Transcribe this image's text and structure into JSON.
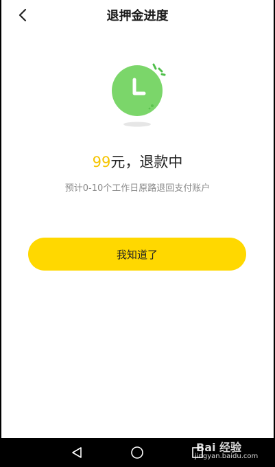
{
  "header": {
    "title": "退押金进度"
  },
  "status": {
    "amount": "99",
    "text": "元，退款中"
  },
  "subtitle": "预计0-10个工作日原路退回支付账户",
  "button": {
    "label": "我知道了"
  },
  "colors": {
    "accent": "#ffd800",
    "amount": "#f5c400",
    "clock": "#7bd66a",
    "clock_dark": "#4fbf4a"
  },
  "icons": {
    "back": "chevron-left-icon",
    "clock": "clock-icon",
    "nav_back": "triangle-back-icon",
    "nav_home": "circle-home-icon",
    "nav_recent": "square-recent-icon"
  },
  "watermark": {
    "main": "Bai 经验",
    "sub": "jingyan.baidu.com"
  }
}
